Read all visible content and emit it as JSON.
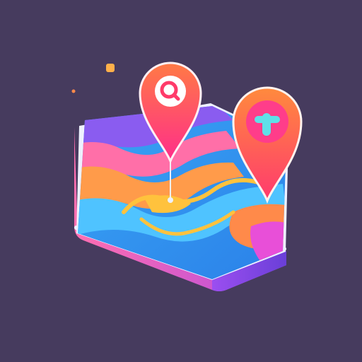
{
  "app_icon": {
    "subject": "isometric-map-tile",
    "colors": {
      "background": "#463b5e",
      "pin_gradient_top": "#ff7a45",
      "pin_gradient_bottom": "#ff2d8a",
      "map_blue": "#2ea8f2",
      "map_orange": "#ff9b4a",
      "map_purple": "#8a5cf0",
      "map_pink": "#ff4fa0",
      "route_yellow": "#ffc23d",
      "tile_side_left": "#7c4bdc",
      "tile_side_front": "#c04ad6",
      "tile_rim": "#eef1ff",
      "confetti_orange": "#ffb04a"
    },
    "icons": [
      "map-pin-search-icon",
      "map-pin-plus-icon",
      "map-tile-icon"
    ]
  }
}
